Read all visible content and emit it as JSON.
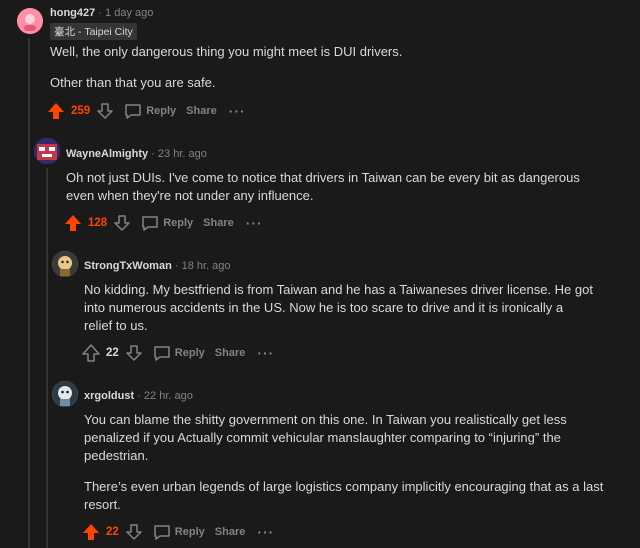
{
  "comments": [
    {
      "username": "hong427",
      "time": "1 day ago",
      "flair": "臺北 - Taipei City",
      "paragraphs": [
        "Well, the only dangerous thing you might meet is DUI drivers.",
        "Other than that you are safe."
      ],
      "score": "259",
      "upvoted": true,
      "reply_label": "Reply",
      "share_label": "Share",
      "more_label": "···",
      "avatar_color": "#ff7b9c"
    },
    {
      "username": "WayneAlmighty",
      "time": "23 hr. ago",
      "paragraphs": [
        "Oh not just DUIs. I've come to notice that drivers in Taiwan can be every bit as dangerous even when they're not under any influence."
      ],
      "score": "128",
      "upvoted": true,
      "reply_label": "Reply",
      "share_label": "Share",
      "more_label": "···",
      "avatar_color": "#c0394b"
    },
    {
      "username": "StrongTxWoman",
      "time": "18 hr. ago",
      "paragraphs": [
        "No kidding. My bestfriend is from Taiwan and he has a Taiwaneses driver license. He got into numerous accidents in the US. Now he is too scare to drive and it is ironically a relief to us."
      ],
      "score": "22",
      "upvoted": false,
      "reply_label": "Reply",
      "share_label": "Share",
      "more_label": "···",
      "avatar_color": "#c8a04a"
    },
    {
      "username": "xrgoldust",
      "time": "22 hr. ago",
      "paragraphs": [
        "You can blame the shitty government on this one. In Taiwan you realistically get less penalized if you Actually commit vehicular manslaughter comparing to “injuring” the pedestrian.",
        "There’s even urban legends of large logistics company implicitly encouraging that as a last resort."
      ],
      "score": "22",
      "upvoted": true,
      "reply_label": "Reply",
      "share_label": "Share",
      "more_label": "···",
      "avatar_color": "#8fb0c4"
    }
  ],
  "colors": {
    "background": "#1a1a1b",
    "upvote": "#ff4500",
    "muted": "#818384",
    "text": "#d7dadc"
  }
}
